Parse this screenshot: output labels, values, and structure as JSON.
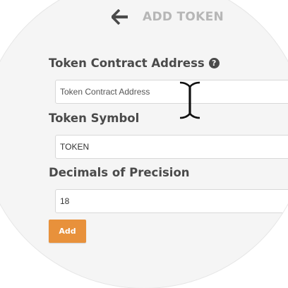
{
  "header": {
    "title": "ADD TOKEN",
    "back_icon": "arrow-left-icon"
  },
  "form": {
    "contract_address": {
      "label": "Token Contract Address",
      "help_icon": "question-circle-icon",
      "help_glyph": "?",
      "value": "",
      "placeholder": "Token Contract Address"
    },
    "symbol": {
      "label": "Token Symbol",
      "value": "TOKEN"
    },
    "decimals": {
      "label": "Decimals of Precision",
      "value": "18"
    },
    "add_button_label": "Add"
  },
  "cursor": {
    "icon": "text-cursor-icon"
  },
  "colors": {
    "accent": "#e8913b",
    "label_text": "#4a4a4a",
    "title_text": "#b6b6b6",
    "background": "#f5f5f5"
  }
}
